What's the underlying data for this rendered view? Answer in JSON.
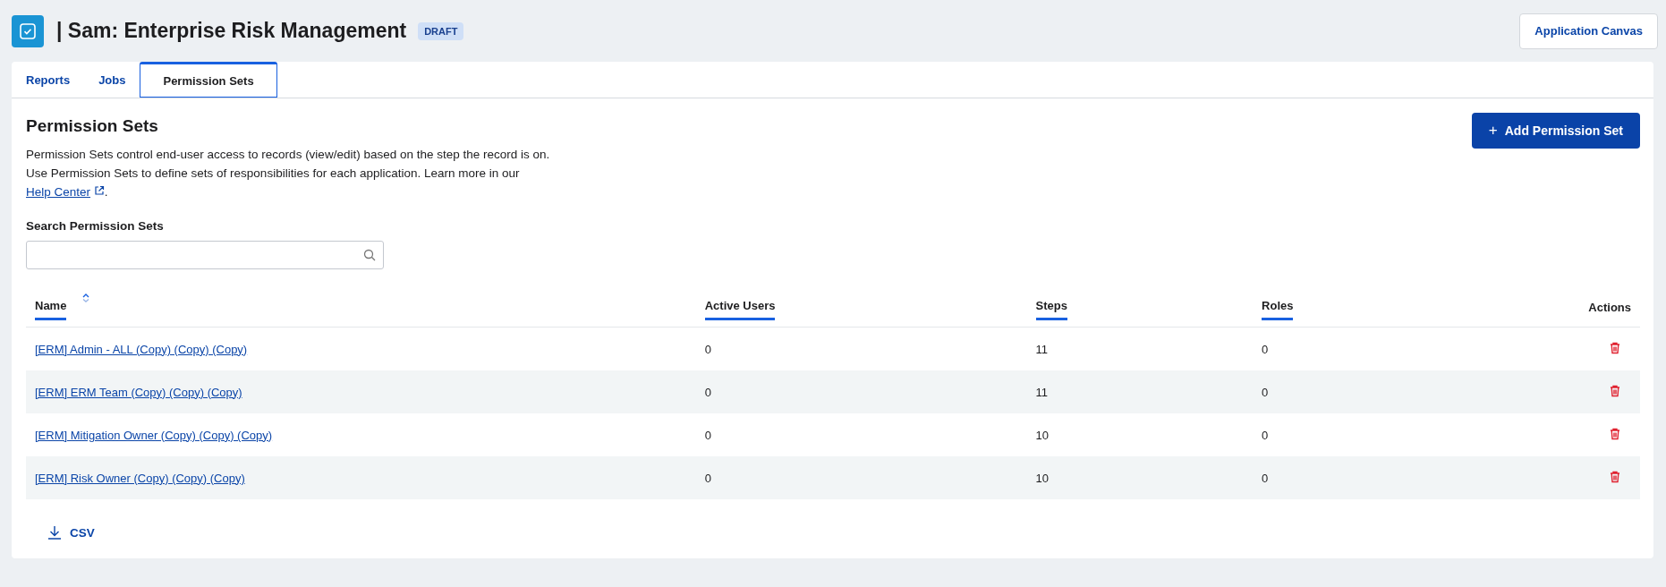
{
  "header": {
    "title": "| Sam: Enterprise Risk Management",
    "badge": "DRAFT",
    "button": "Application Canvas"
  },
  "tabs": [
    {
      "label": "Reports",
      "selected": false
    },
    {
      "label": "Jobs",
      "selected": false
    },
    {
      "label": "Permission Sets",
      "selected": true
    }
  ],
  "section": {
    "heading": "Permission Sets",
    "add_button": "+",
    "add_label": "Add Permission Set",
    "description": [
      "Permission Sets control end-user access to records (view/edit) based on the step the record is on.",
      "Use Permission Sets to define sets of responsibilities for each application. Learn more in our"
    ],
    "link": "Help Center",
    "link_suffix": "."
  },
  "search": {
    "label": "Search Permission Sets"
  },
  "table": {
    "columns": [
      {
        "label": "Name",
        "sortable": true,
        "sorted": true
      },
      {
        "label": "Active Users",
        "sortable": true,
        "sorted": false
      },
      {
        "label": "Steps",
        "sortable": true,
        "sorted": false
      },
      {
        "label": "Roles",
        "sortable": true,
        "sorted": false
      },
      {
        "label": "Actions",
        "sortable": false,
        "sorted": false
      }
    ],
    "rows": [
      {
        "name": "[ERM] Admin - ALL (Copy) (Copy) (Copy)",
        "active_users": "0",
        "steps": "11",
        "roles": "0"
      },
      {
        "name": "[ERM] ERM Team (Copy) (Copy) (Copy)",
        "active_users": "0",
        "steps": "11",
        "roles": "0"
      },
      {
        "name": "[ERM] Mitigation Owner (Copy) (Copy) (Copy)",
        "active_users": "0",
        "steps": "10",
        "roles": "0"
      },
      {
        "name": "[ERM] Risk Owner (Copy) (Copy) (Copy)",
        "active_users": "0",
        "steps": "10",
        "roles": "0"
      }
    ]
  },
  "export": {
    "label": "CSV"
  }
}
